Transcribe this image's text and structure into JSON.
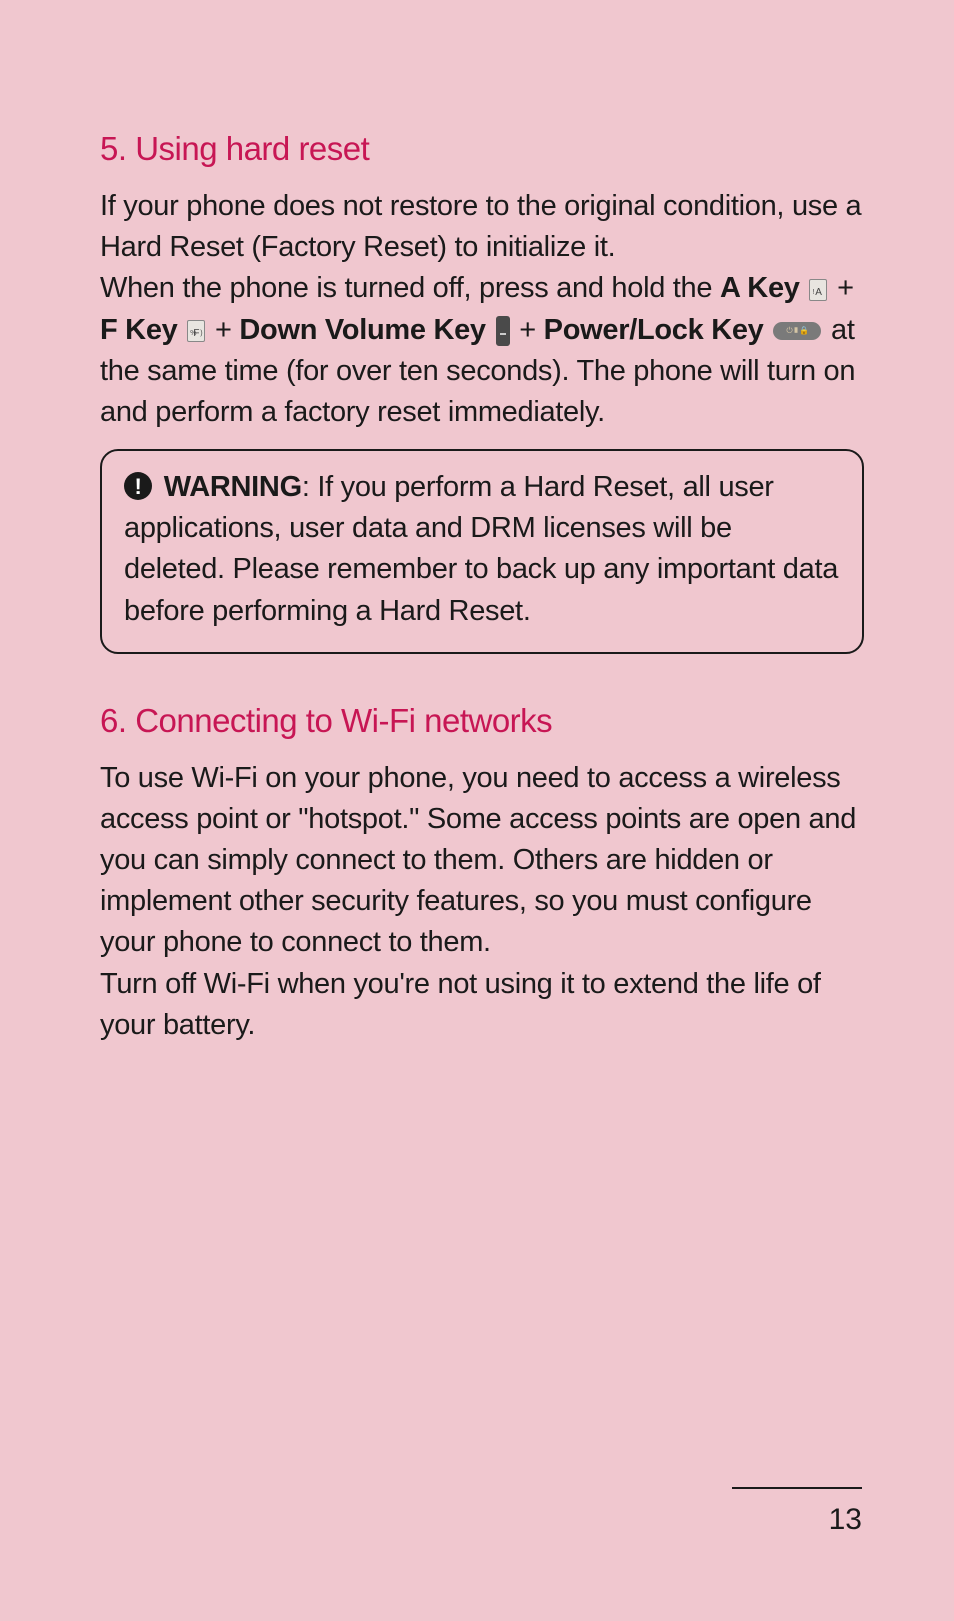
{
  "section5": {
    "heading": "5. Using hard reset",
    "para1": "If your phone does not restore to the original condition, use a Hard Reset (Factory Reset) to initialize it.",
    "para2_part1": "When the phone is turned off, press and hold the ",
    "key_a_label": "A Key",
    "plus1": " + ",
    "key_f_label": "F Key",
    "plus2": " + ",
    "key_volume_label": "Down Volume Key",
    "plus3": " + ",
    "key_power_label": "Power/Lock Key",
    "para2_part2": " at the same time (for over ten seconds). The phone will turn on and perform a factory reset immediately.",
    "warning_label": "WARNING",
    "warning_text": ": If you perform a Hard Reset, all user applications, user data and DRM licenses will be deleted. Please remember to back up any important data before performing a Hard Reset."
  },
  "section6": {
    "heading": "6. Connecting to Wi-Fi networks",
    "para1": "To use Wi-Fi on your phone, you need to access a wireless access point or \"hotspot.\" Some access points are open and you can simply connect to them. Others are hidden or implement other security features, so you must configure your phone to connect to them.",
    "para2": "Turn off Wi-Fi when you're not using it to extend the life of your battery."
  },
  "page_number": "13"
}
